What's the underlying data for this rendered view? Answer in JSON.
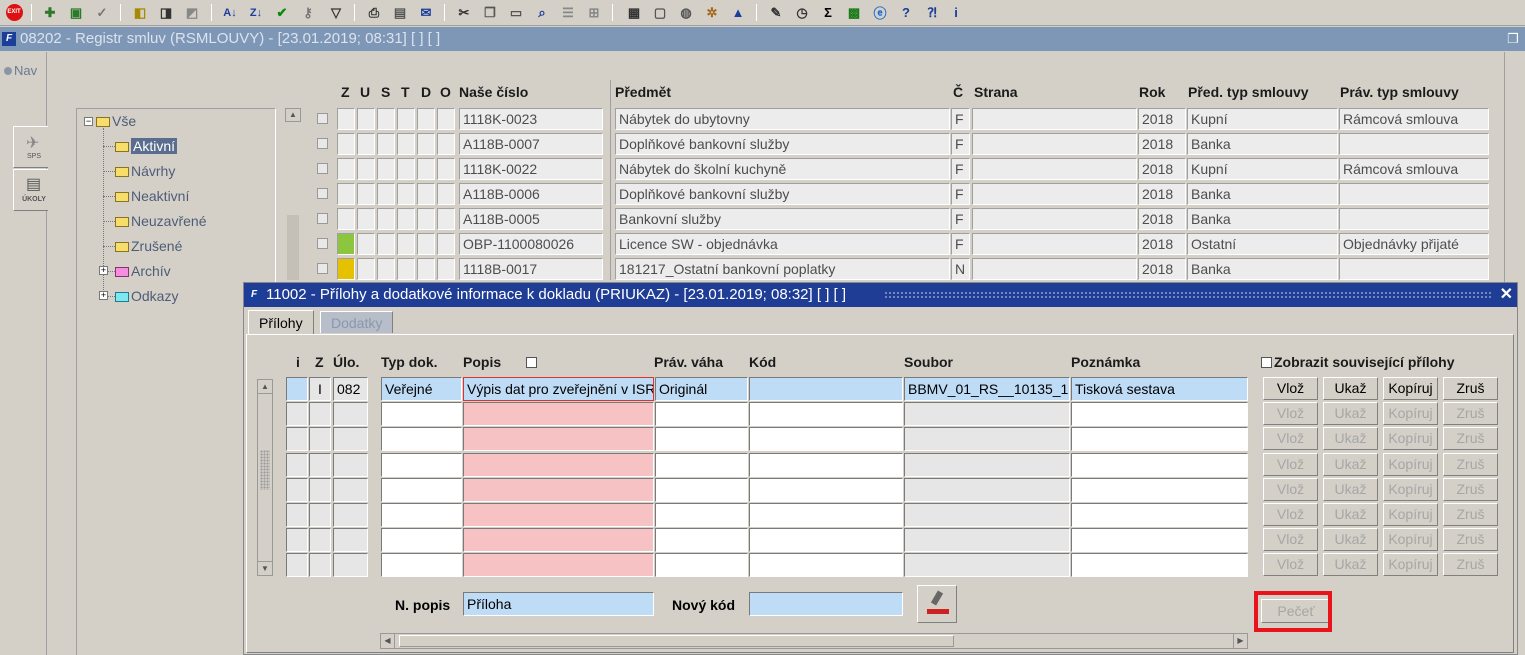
{
  "toolbar": {
    "icons": [
      "exit-icon",
      "add-record-icon",
      "folder-add-icon",
      "check-tool-icon",
      "query-icon",
      "query-run-icon",
      "query-clear-icon",
      "sort-asc-icon",
      "sort-desc-icon",
      "confirm-icon",
      "key-icon",
      "filter-icon",
      "print-icon",
      "print-preview-icon",
      "mail-icon",
      "cut-icon",
      "copy-icon",
      "paste-icon",
      "find-icon",
      "list-icon",
      "tree-icon",
      "document-icon",
      "save-icon",
      "globe-icon",
      "settings-icon",
      "warning-icon",
      "edit-icon",
      "clock-icon",
      "sum-icon",
      "excel-icon",
      "explorer-icon",
      "help-icon",
      "whats-this-icon",
      "info-icon"
    ],
    "exit_label": "EXIT",
    "sum_label": "Σ",
    "help_label": "?",
    "info_label": "i"
  },
  "main_window": {
    "title": "08202 - Registr smluv (RSMLOUVY) - [23.01.2019; 08:31]  [ ]  [ ]",
    "logo": "F"
  },
  "nav": {
    "label": "Nav",
    "buttons": [
      {
        "label": "SPS"
      },
      {
        "label": "ÚKOLY"
      }
    ]
  },
  "tree": {
    "root": "Vše",
    "items": [
      "Aktivní",
      "Návrhy",
      "Neaktivní",
      "Neuzavřené",
      "Zrušené",
      "Archív",
      "Odkazy"
    ]
  },
  "grid": {
    "headers": {
      "z": "Z",
      "u": "U",
      "s": "S",
      "t": "T",
      "d": "D",
      "o": "O",
      "nase_cislo": "Naše číslo",
      "predmet": "Předmět",
      "c": "Č",
      "strana": "Strana",
      "rok": "Rok",
      "pred_typ": "Před. typ smlouvy",
      "prav_typ": "Práv. typ smlouvy"
    },
    "rows": [
      {
        "nase_cislo": "1118K-0023",
        "predmet": "Nábytek do ubytovny",
        "c": "F",
        "strana": "",
        "rok": "2018",
        "pred_typ": "Kupní",
        "prav_typ": "Rámcová smlouva",
        "status_color": ""
      },
      {
        "nase_cislo": "A118B-0007",
        "predmet": "Doplňkové bankovní služby",
        "c": "F",
        "strana": "",
        "rok": "2018",
        "pred_typ": "Banka",
        "prav_typ": "",
        "status_color": ""
      },
      {
        "nase_cislo": "1118K-0022",
        "predmet": "Nábytek do školní kuchyně",
        "c": "F",
        "strana": "",
        "rok": "2018",
        "pred_typ": "Kupní",
        "prav_typ": "Rámcová smlouva",
        "status_color": ""
      },
      {
        "nase_cislo": "A118B-0006",
        "predmet": "Doplňkové bankovní služby",
        "c": "F",
        "strana": "",
        "rok": "2018",
        "pred_typ": "Banka",
        "prav_typ": "",
        "status_color": ""
      },
      {
        "nase_cislo": "A118B-0005",
        "predmet": "Bankovní služby",
        "c": "F",
        "strana": "",
        "rok": "2018",
        "pred_typ": "Banka",
        "prav_typ": "",
        "status_color": ""
      },
      {
        "nase_cislo": "OBP-1100080026",
        "predmet": "Licence SW - objednávka",
        "c": "F",
        "strana": "",
        "rok": "2018",
        "pred_typ": "Ostatní",
        "prav_typ": "Objednávky přijaté",
        "status_color": "#8cc63f"
      },
      {
        "nase_cislo": "1118B-0017",
        "predmet": "181217_Ostatní bankovní poplatky",
        "c": "N",
        "strana": "",
        "rok": "2018",
        "pred_typ": "Banka",
        "prav_typ": "",
        "status_color": "#e5c100"
      }
    ]
  },
  "dialog": {
    "title": "11002 - Přílohy a dodatkové informace k dokladu (PRIUKAZ) - [23.01.2019; 08:32]  [ ]  [ ]",
    "logo": "F",
    "close": "✕",
    "tabs": [
      "Přílohy",
      "Dodatky"
    ],
    "headers": {
      "i": "i",
      "z": "Z",
      "ulo": "Úlo.",
      "typ_dok": "Typ dok.",
      "popis": "Popis",
      "prav_vaha": "Práv. váha",
      "kod": "Kód",
      "soubor": "Soubor",
      "poznamka": "Poznámka",
      "show_related": "Zobrazit související přílohy"
    },
    "rows": [
      {
        "i": "",
        "z": "I",
        "ulo": "082",
        "typ_dok": "Veřejné",
        "popis": "Výpis dat pro zveřejnění v ISR",
        "prav_vaha": "Originál",
        "kod": "",
        "soubor": "BBMV_01_RS__10135_1",
        "poznamka": "Tisková sestava"
      },
      {
        "i": "",
        "z": "",
        "ulo": "",
        "typ_dok": "",
        "popis": "",
        "prav_vaha": "",
        "kod": "",
        "soubor": "",
        "poznamka": ""
      },
      {
        "i": "",
        "z": "",
        "ulo": "",
        "typ_dok": "",
        "popis": "",
        "prav_vaha": "",
        "kod": "",
        "soubor": "",
        "poznamka": ""
      },
      {
        "i": "",
        "z": "",
        "ulo": "",
        "typ_dok": "",
        "popis": "",
        "prav_vaha": "",
        "kod": "",
        "soubor": "",
        "poznamka": ""
      },
      {
        "i": "",
        "z": "",
        "ulo": "",
        "typ_dok": "",
        "popis": "",
        "prav_vaha": "",
        "kod": "",
        "soubor": "",
        "poznamka": ""
      },
      {
        "i": "",
        "z": "",
        "ulo": "",
        "typ_dok": "",
        "popis": "",
        "prav_vaha": "",
        "kod": "",
        "soubor": "",
        "poznamka": ""
      },
      {
        "i": "",
        "z": "",
        "ulo": "",
        "typ_dok": "",
        "popis": "",
        "prav_vaha": "",
        "kod": "",
        "soubor": "",
        "poznamka": ""
      },
      {
        "i": "",
        "z": "",
        "ulo": "",
        "typ_dok": "",
        "popis": "",
        "prav_vaha": "",
        "kod": "",
        "soubor": "",
        "poznamka": ""
      }
    ],
    "row_buttons": {
      "insert": "Vlož",
      "show": "Ukaž",
      "copy": "Kopíruj",
      "cancel": "Zruš"
    },
    "new_desc_label": "N. popis",
    "new_desc_value": "Příloha",
    "new_code_label": "Nový kód",
    "new_code_value": "",
    "seal_button": "Pečeť"
  },
  "colors": {
    "main_title_bg": "#7e97b7",
    "dialog_title_bg": "#1f3d94",
    "highlight_frame": "#e8131b",
    "row_selected": "#bfdcf7",
    "required_field": "#f7c2c4"
  }
}
